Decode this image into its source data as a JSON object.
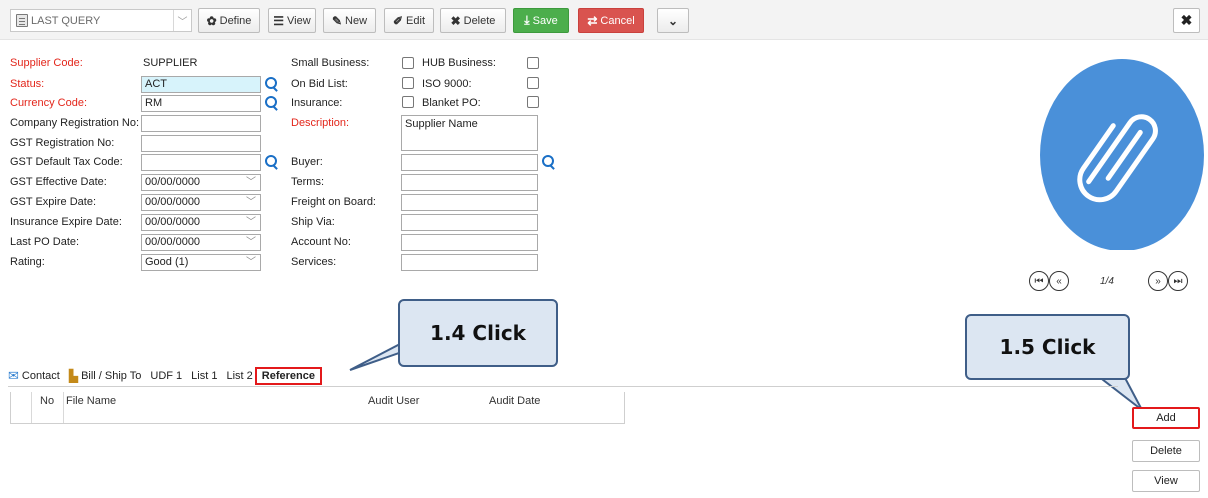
{
  "toolbar": {
    "query": "LAST QUERY",
    "define": "Define",
    "view": "View",
    "new": "New",
    "edit": "Edit",
    "delete": "Delete",
    "save": "Save",
    "cancel": "Cancel",
    "close": "✖"
  },
  "form": {
    "supplier_code_label": "Supplier Code:",
    "supplier_code": "SUPPLIER",
    "status_label": "Status:",
    "status": "ACT",
    "currency_label": "Currency Code:",
    "currency": "RM",
    "company_reg_label": "Company Registration No:",
    "company_reg": "",
    "gst_reg_label": "GST Registration No:",
    "gst_reg": "",
    "gst_tax_label": "GST Default Tax Code:",
    "gst_tax": "",
    "gst_eff_label": "GST Effective Date:",
    "gst_eff": "00/00/0000",
    "gst_exp_label": "GST Expire Date:",
    "gst_exp": "00/00/0000",
    "ins_exp_label": "Insurance Expire Date:",
    "ins_exp": "00/00/0000",
    "last_po_label": "Last PO Date:",
    "last_po": "00/00/0000",
    "rating_label": "Rating:",
    "rating": "Good (1)",
    "small_business_label": "Small Business:",
    "on_bid_label": "On Bid List:",
    "insurance_label": "Insurance:",
    "description_label": "Description:",
    "description": "Supplier Name",
    "buyer_label": "Buyer:",
    "terms_label": "Terms:",
    "fob_label": "Freight on Board:",
    "ship_via_label": "Ship Via:",
    "account_label": "Account No:",
    "services_label": "Services:",
    "hub_label": "HUB Business:",
    "iso_label": "ISO 9000:",
    "blanket_label": "Blanket PO:"
  },
  "preview": {
    "page": "1/4"
  },
  "callouts": {
    "c14": "1.4 Click",
    "c15": "1.5 Click"
  },
  "tabs": [
    "Contact",
    "Bill / Ship To",
    "UDF 1",
    "List 1",
    "List 2",
    "Reference"
  ],
  "grid": {
    "columns": [
      "No",
      "File Name",
      "Audit User",
      "Audit Date"
    ]
  },
  "side": {
    "add": "Add",
    "delete": "Delete",
    "view": "View"
  },
  "colors": {
    "required_label": "#e3261b",
    "accent_blue": "#4a90d9",
    "save_green": "#4cae4c",
    "cancel_red": "#d9534f",
    "highlight_red": "#e3191b",
    "callout_fill": "#dce6f2"
  }
}
